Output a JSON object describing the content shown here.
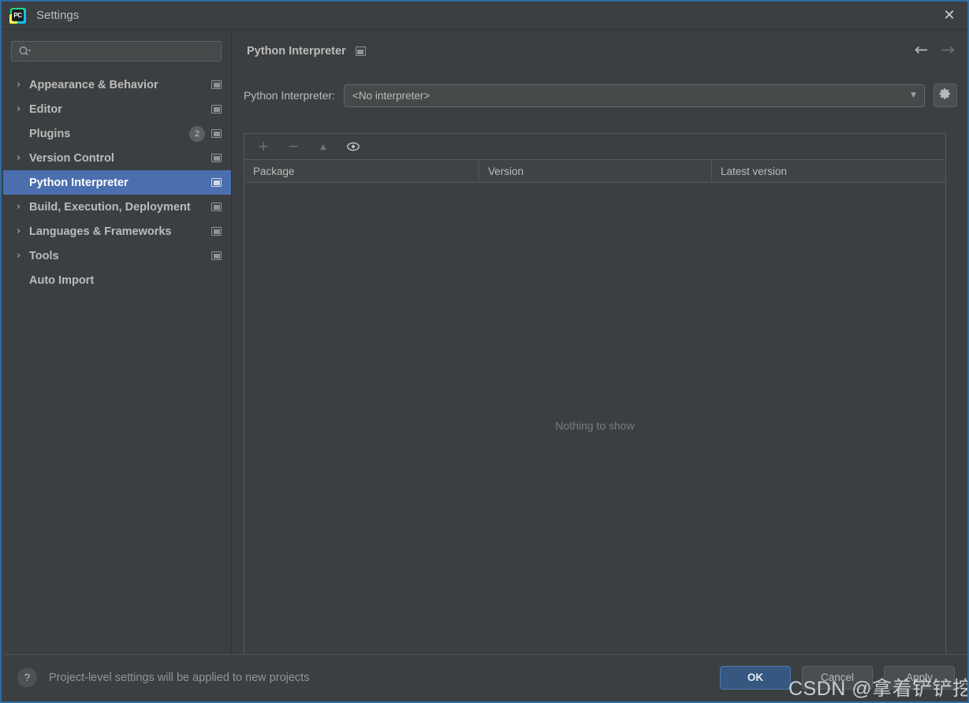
{
  "window": {
    "title": "Settings",
    "logo_text": "PC",
    "close_label": "✕",
    "accent_color": "#2d6ca2",
    "selection_color": "#4b6eaf",
    "background_color": "#3c3f41"
  },
  "sidebar": {
    "search": {
      "placeholder": "",
      "value": "",
      "icon": "search-icon"
    },
    "items": [
      {
        "label": "Appearance & Behavior",
        "arrow": "›",
        "expandable": true,
        "selected": false,
        "scope_icon": true,
        "badge": null
      },
      {
        "label": "Editor",
        "arrow": "›",
        "expandable": true,
        "selected": false,
        "scope_icon": true,
        "badge": null
      },
      {
        "label": "Plugins",
        "arrow": "",
        "expandable": false,
        "selected": false,
        "scope_icon": true,
        "badge": "2"
      },
      {
        "label": "Version Control",
        "arrow": "›",
        "expandable": true,
        "selected": false,
        "scope_icon": true,
        "badge": null
      },
      {
        "label": "Python Interpreter",
        "arrow": "",
        "expandable": false,
        "selected": true,
        "scope_icon": true,
        "badge": null
      },
      {
        "label": "Build, Execution, Deployment",
        "arrow": "›",
        "expandable": true,
        "selected": false,
        "scope_icon": true,
        "badge": null
      },
      {
        "label": "Languages & Frameworks",
        "arrow": "›",
        "expandable": true,
        "selected": false,
        "scope_icon": true,
        "badge": null
      },
      {
        "label": "Tools",
        "arrow": "›",
        "expandable": true,
        "selected": false,
        "scope_icon": true,
        "badge": null
      },
      {
        "label": "Auto Import",
        "arrow": "",
        "expandable": false,
        "selected": false,
        "scope_icon": false,
        "badge": null
      }
    ]
  },
  "main": {
    "header": {
      "title": "Python Interpreter",
      "scope_icon": "project-scope-icon",
      "back_arrow": "←",
      "forward_arrow": "→"
    },
    "interpreter": {
      "label": "Python Interpreter:",
      "value": "<No interpreter>",
      "caret": "▼",
      "gear_icon": "gear-icon"
    },
    "packages": {
      "toolbar": [
        {
          "name": "add-package-button",
          "glyph": "+"
        },
        {
          "name": "remove-package-button",
          "glyph": "−"
        },
        {
          "name": "upgrade-package-button",
          "glyph": "▲"
        },
        {
          "name": "show-early-releases-button",
          "glyph": "eye"
        }
      ],
      "columns": [
        "Package",
        "Version",
        "Latest version"
      ],
      "rows": [],
      "empty_text": "Nothing to show"
    }
  },
  "footer": {
    "help_label": "?",
    "note": "Project-level settings will be applied to new projects",
    "buttons": [
      {
        "label": "OK",
        "primary": true,
        "name": "ok-button"
      },
      {
        "label": "Cancel",
        "primary": false,
        "name": "cancel-button"
      },
      {
        "label": "Apply",
        "primary": false,
        "name": "apply-button"
      }
    ]
  },
  "watermark": {
    "text": "CSDN @拿着铲铲挖挖挖"
  }
}
